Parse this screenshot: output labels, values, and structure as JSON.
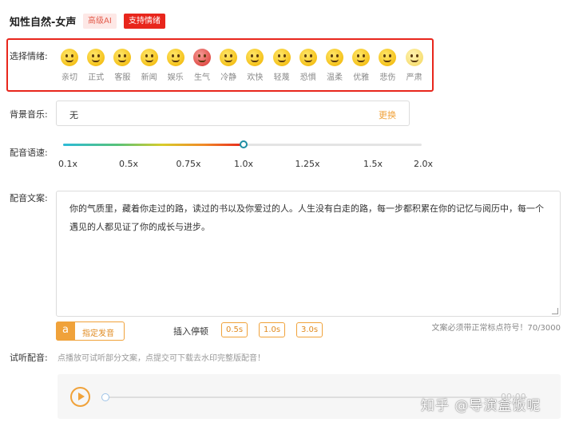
{
  "voice": {
    "title": "知性自然-女声",
    "badge_ai": "高级AI",
    "badge_emotion": "支持情绪"
  },
  "emotion": {
    "label": "选择情绪:",
    "items": [
      {
        "label": "亲切",
        "icon": "laughing-face-icon"
      },
      {
        "label": "正式",
        "icon": "grinning-face-icon"
      },
      {
        "label": "客服",
        "icon": "winking-face-icon"
      },
      {
        "label": "新闻",
        "icon": "smiling-face-icon"
      },
      {
        "label": "娱乐",
        "icon": "tongue-face-icon"
      },
      {
        "label": "生气",
        "icon": "angry-face-icon"
      },
      {
        "label": "冷静",
        "icon": "neutral-face-icon"
      },
      {
        "label": "欢快",
        "icon": "squinting-laugh-face-icon"
      },
      {
        "label": "轻蔑",
        "icon": "surprised-face-icon"
      },
      {
        "label": "恐惧",
        "icon": "fearful-face-icon"
      },
      {
        "label": "温柔",
        "icon": "gentle-face-icon"
      },
      {
        "label": "优雅",
        "icon": "sly-face-icon"
      },
      {
        "label": "悲伤",
        "icon": "sad-face-icon"
      },
      {
        "label": "严肃",
        "icon": "serious-face-icon"
      }
    ],
    "selected_color": "#e8261c"
  },
  "music": {
    "label": "背景音乐:",
    "value": "无",
    "change": "更换"
  },
  "speed": {
    "label": "配音语速:",
    "ticks": [
      "0.1x",
      "0.5x",
      "0.75x",
      "1.0x",
      "1.25x",
      "1.5x",
      "2.0x"
    ],
    "selected": "1.0x"
  },
  "script": {
    "label": "配音文案:",
    "text": "你的气质里，藏着你走过的路，读过的书以及你爱过的人。人生没有白走的路，每一步都积累在你的记忆与阅历中，每一个遇见的人都见证了你的成长与进步。"
  },
  "tools": {
    "pronunciation_icon": "a",
    "pronunciation": "指定发音",
    "pause_label": "插入停顿",
    "pauses": [
      "0.5s",
      "1.0s",
      "3.0s"
    ],
    "counter": "文案必须带正常标点符号！70/3000"
  },
  "listen": {
    "label": "试听配音:",
    "hint": "点播放可试听部分文案，点提交可下载去水印完整版配音！",
    "time": "00:00"
  },
  "watermark": "知乎 @导演盒饭呢",
  "colors": {
    "accent": "#f0a23a",
    "danger": "#e8261c"
  }
}
